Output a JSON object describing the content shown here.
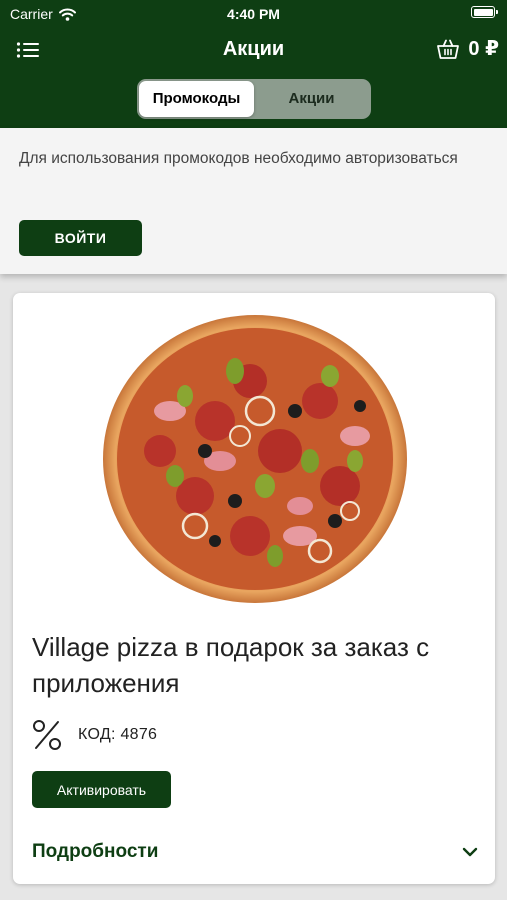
{
  "status_bar": {
    "carrier": "Carrier",
    "time": "4:40 PM"
  },
  "nav": {
    "title": "Акции",
    "cart_total": "0 ₽"
  },
  "tabs": [
    {
      "label": "Промокоды",
      "active": true
    },
    {
      "label": "Акции",
      "active": false
    }
  ],
  "auth": {
    "message": "Для использования промокодов необходимо авторизоваться",
    "login_label": "ВОЙТИ"
  },
  "promo": {
    "title": "Village pizza в подарок за заказ с приложения",
    "code_label": "КОД: 4876",
    "activate_label": "Активировать",
    "details_label": "Подробности"
  },
  "colors": {
    "brand_green": "#0e3e13",
    "segment_bg": "#8c9c8e",
    "page_bg": "#e6e6e6"
  },
  "icons": [
    "wifi-icon",
    "battery-icon",
    "menu-icon",
    "basket-icon",
    "percent-icon",
    "chevron-down-icon"
  ]
}
